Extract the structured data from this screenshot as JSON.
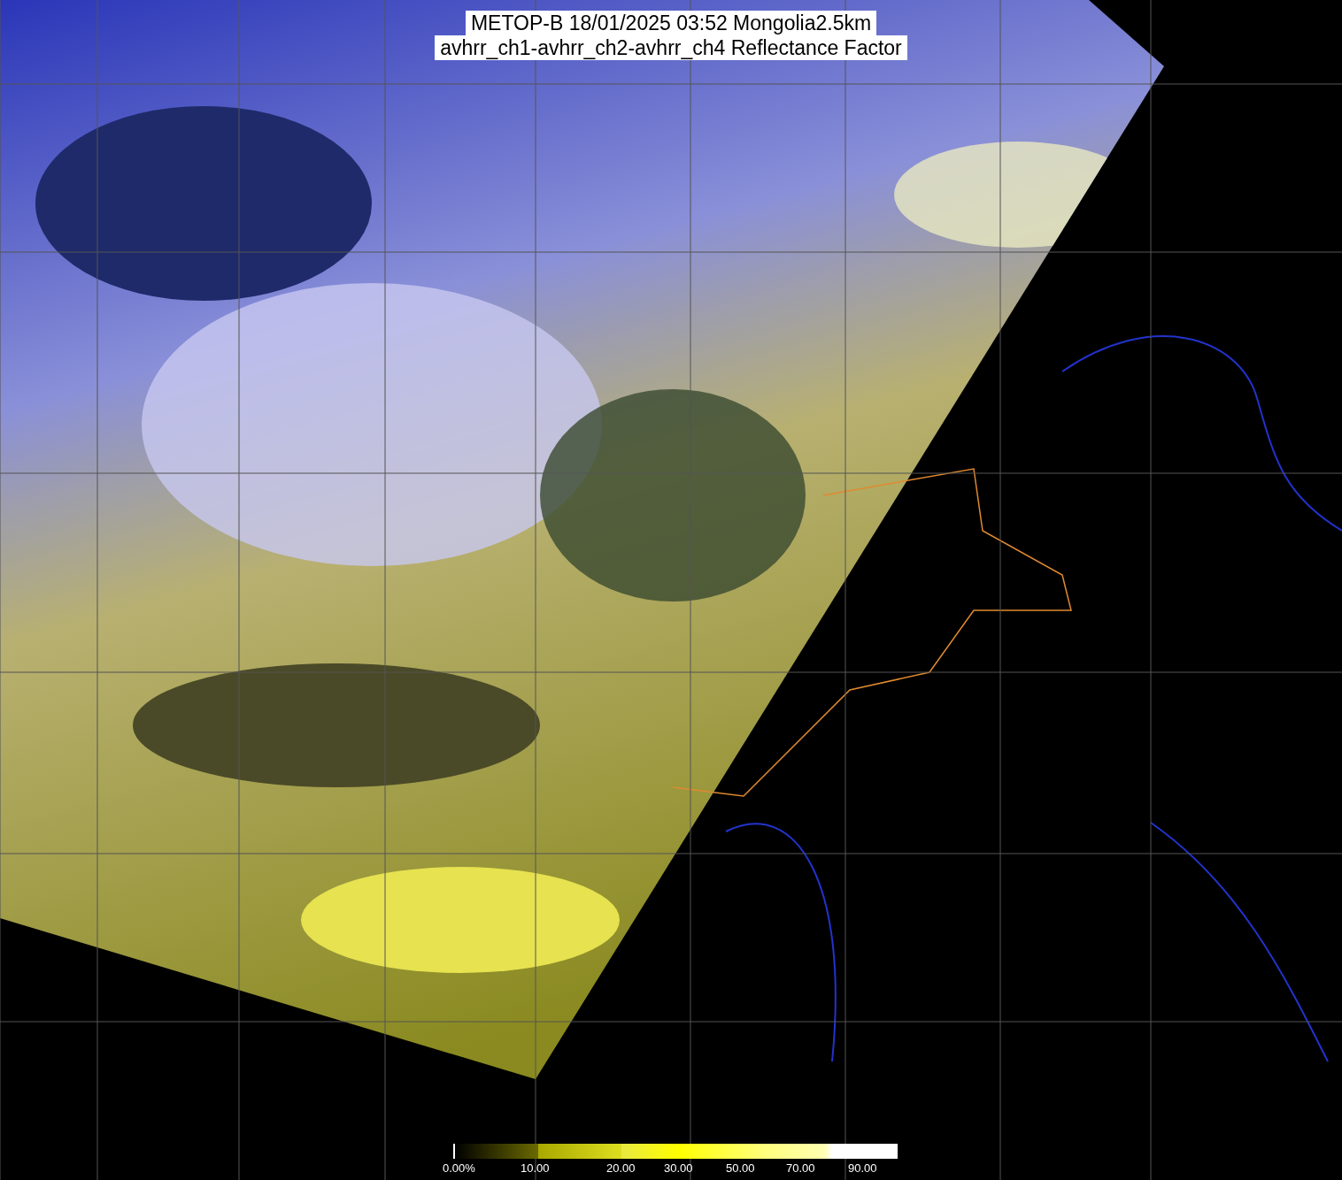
{
  "title_lines": [
    "METOP-B 18/01/2025 03:52 Mongolia2.5km",
    "avhrr_ch1-avhrr_ch2-avhrr_ch4 Reflectance Factor"
  ],
  "colorbar": {
    "labels": [
      "0.00%",
      "10.00",
      "20.00",
      "30.00",
      "50.00",
      "70.00",
      "90.00"
    ]
  }
}
